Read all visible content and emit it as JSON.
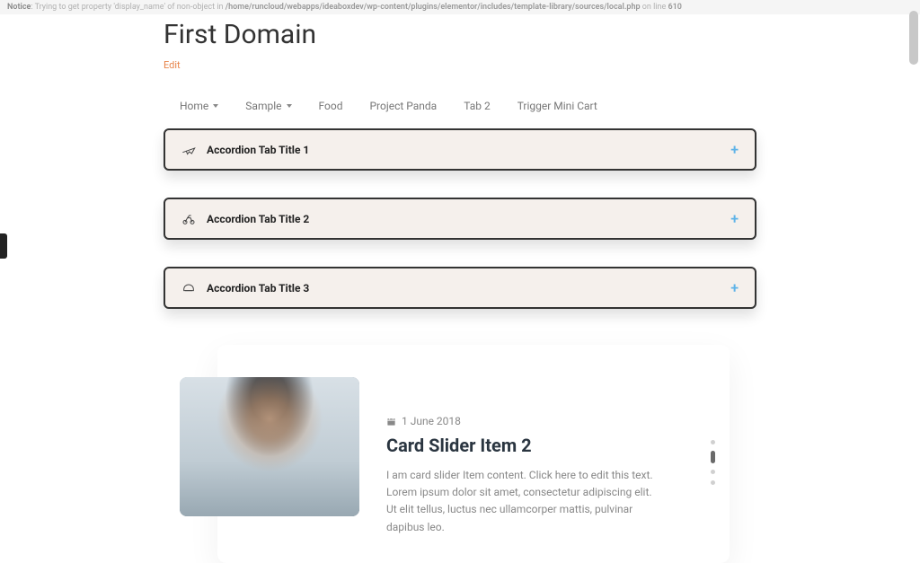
{
  "error": {
    "prefix": "Notice",
    "message": ": Trying to get property 'display_name' of non-object in ",
    "path": "/home/runcloud/webapps/ideaboxdev/wp-content/plugins/elementor/includes/template-library/sources/local.php",
    "on_line": " on line ",
    "line": "610"
  },
  "page": {
    "title": "First Domain",
    "edit": "Edit"
  },
  "nav": [
    {
      "label": "Home",
      "has_caret": true
    },
    {
      "label": "Sample",
      "has_caret": true
    },
    {
      "label": "Food",
      "has_caret": false
    },
    {
      "label": "Project Panda",
      "has_caret": false
    },
    {
      "label": "Tab 2",
      "has_caret": false
    },
    {
      "label": "Trigger Mini Cart",
      "has_caret": false
    }
  ],
  "accordion": [
    {
      "title": "Accordion Tab Title 1",
      "icon": "plane"
    },
    {
      "title": "Accordion Tab Title 2",
      "icon": "bike"
    },
    {
      "title": "Accordion Tab Title 3",
      "icon": "helmet"
    }
  ],
  "card": {
    "date": "1 June 2018",
    "title": "Card Slider Item 2",
    "description": "I am card slider Item content. Click here to edit this text. Lorem ipsum dolor sit amet, consectetur adipiscing elit. Ut elit tellus, luctus nec ullamcorper mattis, pulvinar dapibus leo."
  }
}
